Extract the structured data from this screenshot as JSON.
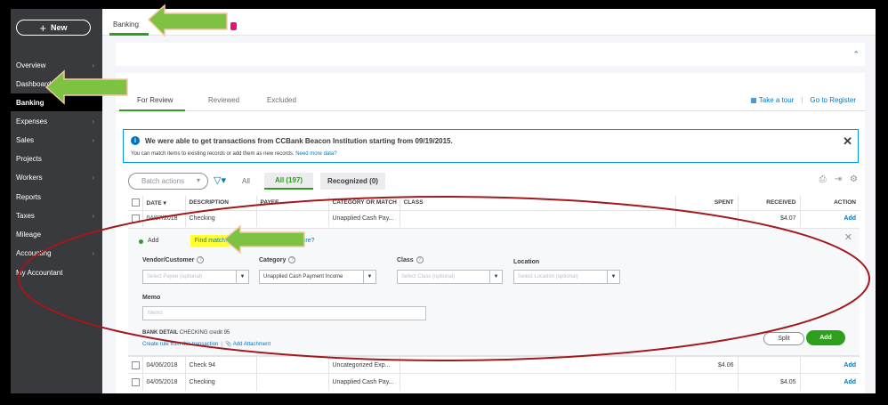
{
  "sidebar": {
    "new_label": "New",
    "items": [
      {
        "label": "Overview",
        "chevron": true
      },
      {
        "label": "Dashboard",
        "chevron": false
      },
      {
        "label": "Banking",
        "chevron": false,
        "active": true
      },
      {
        "label": "Expenses",
        "chevron": true
      },
      {
        "label": "Sales",
        "chevron": true
      },
      {
        "label": "Projects",
        "chevron": false
      },
      {
        "label": "Workers",
        "chevron": true
      },
      {
        "label": "Reports",
        "chevron": false
      },
      {
        "label": "Taxes",
        "chevron": true
      },
      {
        "label": "Mileage",
        "chevron": false
      },
      {
        "label": "Accounting",
        "chevron": true
      },
      {
        "label": "My Accountant",
        "chevron": false
      }
    ]
  },
  "topbar": {
    "tab_label": "Banking"
  },
  "subtabs": {
    "for_review": "For Review",
    "reviewed": "Reviewed",
    "excluded": "Excluded"
  },
  "top_links": {
    "take_tour": "Take a tour",
    "go_register": "Go to Register",
    "separator": "|"
  },
  "banner": {
    "title": "We were able to get transactions from CCBank Beacon Institution starting from 09/19/2015.",
    "sub_text": "You can match items to existing records or add them as new records.",
    "sub_link": "Need more data?"
  },
  "toolbar": {
    "batch_actions": "Batch actions",
    "all_label": "All",
    "all_pill": "All (197)",
    "recognized_pill": "Recognized (0)"
  },
  "table": {
    "headers": [
      "DATE ▾",
      "DESCRIPTION",
      "PAYEE",
      "CATEGORY OR MATCH",
      "CLASS",
      "SPENT",
      "RECEIVED",
      "ACTION"
    ],
    "first_row": {
      "date": "04/07/2018",
      "description": "Checking",
      "payee": "",
      "category": "Unapplied Cash Pay...",
      "class": "",
      "spent": "",
      "received": "$4.07",
      "action": "Add"
    },
    "lower_rows": [
      {
        "date": "04/06/2018",
        "description": "Check 94",
        "payee": "",
        "category": "Uncategorized Exp...",
        "class": "",
        "spent": "$4.06",
        "received": "",
        "action": "Add"
      },
      {
        "date": "04/05/2018",
        "description": "Checking",
        "payee": "",
        "category": "Unapplied Cash Pay...",
        "class": "",
        "spent": "",
        "received": "$4.05",
        "action": "Add"
      }
    ]
  },
  "edit_panel": {
    "radio_add": "Add",
    "find_match": "Find match",
    "sure_text": "sure?",
    "vendor_label": "Vendor/Customer",
    "vendor_placeholder": "Select Payee (optional)",
    "category_label": "Category",
    "category_value": "Unapplied Cash Payment Income",
    "class_label": "Class",
    "class_placeholder": "Select Class (optional)",
    "location_label": "Location",
    "location_placeholder": "Select Location (optional)",
    "memo_label": "Memo",
    "memo_placeholder": "Memo",
    "bank_detail_label": "BANK DETAIL",
    "bank_detail_value": "CHECKING credit 95",
    "create_rule": "Create rule from this transaction",
    "add_attachment": "Add Attachment",
    "split_label": "Split",
    "add_label": "Add"
  },
  "colors": {
    "accent_green": "#2ca01c",
    "link_blue": "#0077c5",
    "sidebar_bg": "#393a3d",
    "annotation_arrow": "#7dc242",
    "annotation_ellipse": "#a3181b",
    "highlight_yellow": "#ffff33"
  },
  "icons": {
    "info": "info-icon",
    "close": "close-icon",
    "filter": "filter-icon",
    "print": "print-icon",
    "export": "export-icon",
    "settings": "gear-icon",
    "tour": "tour-icon",
    "question": "help-icon"
  }
}
